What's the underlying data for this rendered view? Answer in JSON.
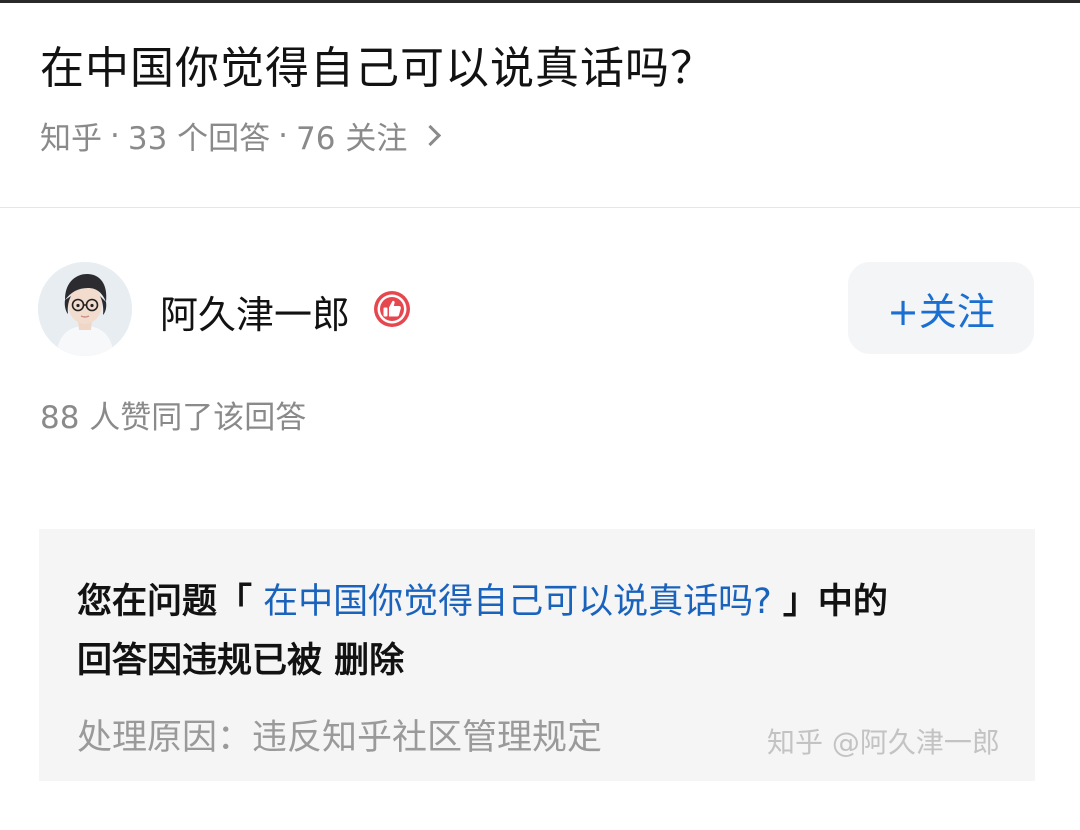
{
  "question": {
    "title": "在中国你觉得自己可以说真话吗？",
    "source": "知乎",
    "answers": "33 个回答",
    "followers": "76 关注",
    "separator": "·"
  },
  "answer": {
    "author_name": "阿久津一郎",
    "badge_icon": "thumbs-up-badge-icon",
    "follow_label": "+关注",
    "like_text": "88 人赞同了该回答"
  },
  "notice": {
    "prefix": "您在问题「",
    "question_link": " 在中国你觉得自己可以说真话吗? ",
    "suffix": "」中的",
    "line2": "回答因违规已被 删除",
    "reason": "处理原因：违反知乎社区管理规定"
  },
  "watermark": "知乎 @阿久津一郎",
  "colors": {
    "accent_blue": "#1a6fd1",
    "link_blue": "#1a63bd",
    "badge_red": "#e6474f",
    "muted_text": "#8a8a8a"
  }
}
